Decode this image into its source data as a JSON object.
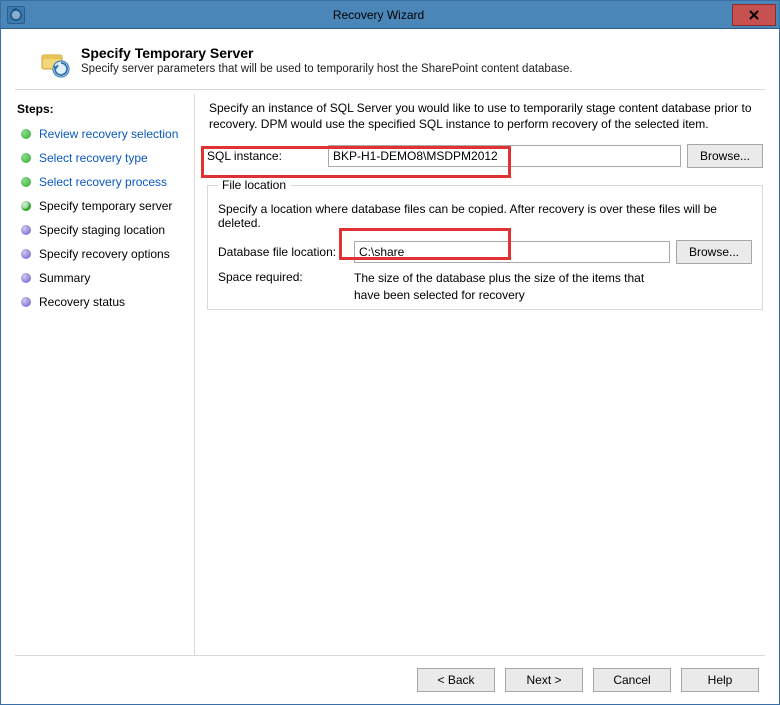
{
  "window": {
    "title": "Recovery Wizard"
  },
  "heading": {
    "title": "Specify Temporary Server",
    "subtitle": "Specify server parameters that will be used to temporarily host the SharePoint content database."
  },
  "steps": {
    "title": "Steps:",
    "items": [
      {
        "label": "Review recovery selection",
        "state": "past"
      },
      {
        "label": "Select recovery type",
        "state": "past"
      },
      {
        "label": "Select recovery process",
        "state": "past"
      },
      {
        "label": "Specify temporary server",
        "state": "current"
      },
      {
        "label": "Specify staging location",
        "state": "future"
      },
      {
        "label": "Specify recovery options",
        "state": "future"
      },
      {
        "label": "Summary",
        "state": "future"
      },
      {
        "label": "Recovery status",
        "state": "future"
      }
    ]
  },
  "main": {
    "description": "Specify an instance of SQL Server you would like to use to temporarily stage content database prior to recovery. DPM would use the specified SQL instance to perform recovery of the selected item.",
    "sql_instance_label": "SQL instance:",
    "sql_instance_value": "BKP-H1-DEMO8\\MSDPM2012",
    "browse_label": "Browse...",
    "file_location": {
      "legend": "File location",
      "description": "Specify a location where database files can be copied. After recovery is over these files will be deleted.",
      "db_file_location_label": "Database file location:",
      "db_file_location_value": "C:\\share",
      "space_required_label": "Space required:",
      "space_required_value": "The size of the database plus the size of the items that have been selected for recovery"
    }
  },
  "footer": {
    "back": "< Back",
    "next": "Next >",
    "cancel": "Cancel",
    "help": "Help"
  }
}
